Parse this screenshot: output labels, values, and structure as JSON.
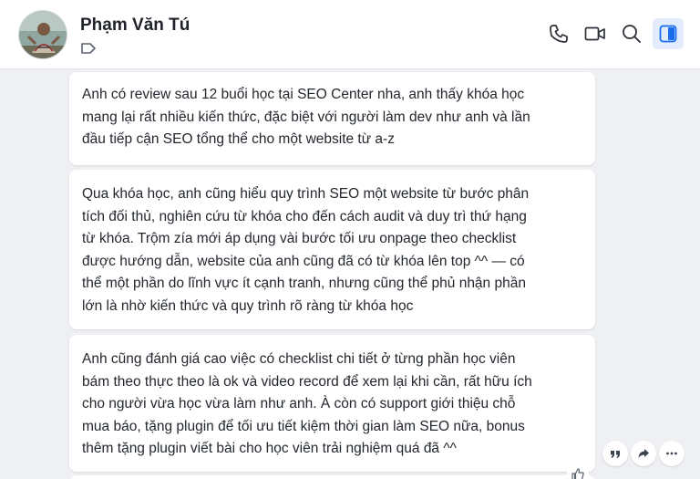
{
  "header": {
    "contact_name": "Phạm Văn Tú",
    "icons": [
      "phone-icon",
      "video-call-icon",
      "search-icon",
      "sidebar-toggle-icon"
    ],
    "accent_color": "#1a6cf0"
  },
  "messages": [
    {
      "lines": [
        "Anh có review sau 12 buổi học tại SEO Center nha, anh thấy khóa học",
        "mang lại rất nhiều kiến thức, đặc biệt với người làm dev như anh và lần",
        "đầu tiếp cận SEO tổng thể cho một website từ a-z"
      ]
    },
    {
      "lines": [
        "Qua khóa học, anh cũng hiểu quy trình SEO một website từ bước phân",
        "tích đối thủ, nghiên cứu từ khóa cho đến cách audit và duy trì thứ hạng",
        "từ khóa. Trộm zía mới áp dụng vài bước tối ưu onpage theo checklist",
        "được hướng dẫn, website của anh cũng đã có từ khóa lên top ^^ — có",
        "thể một phần do lĩnh vực ít cạnh tranh, nhưng cũng thể phủ nhận phần",
        "lớn là nhờ kiến thức và quy trình rõ ràng từ khóa học"
      ]
    },
    {
      "lines": [
        "Anh cũng đánh giá cao việc có checklist chi tiết ở từng phần học viên",
        "bám theo thực theo là ok và video record để xem lại khi cần, rất hữu ích",
        "cho người vừa học vừa làm như anh. À còn có support giới thiệu chỗ",
        "mua báo, tặng plugin để tối ưu tiết kiệm thời gian làm SEO nữa, bonus",
        "thêm tặng plugin viết bài cho học viên trải nghiệm quá đã ^^"
      ]
    }
  ],
  "message_actions": [
    "quote-icon",
    "forward-icon",
    "more-icon",
    "like-icon"
  ]
}
